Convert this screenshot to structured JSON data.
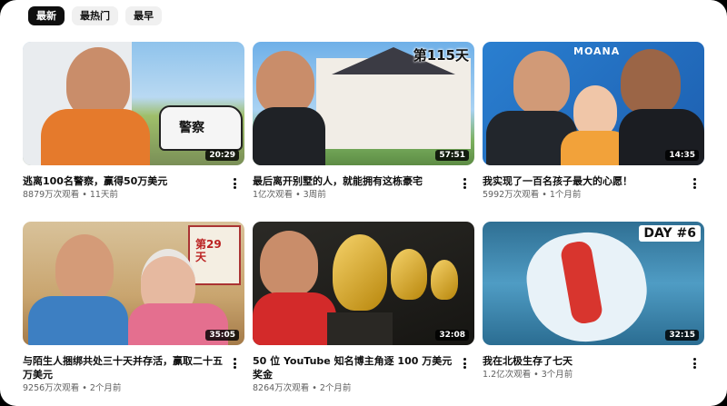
{
  "chips": [
    "最新",
    "最热门",
    "最早"
  ],
  "videos": [
    {
      "title": "逃离100名警察，赢得50万美元",
      "meta": "8879万次观看 • 11天前",
      "duration": "20:29",
      "overlay": "警察"
    },
    {
      "title": "最后离开别墅的人，就能拥有这栋豪宅",
      "meta": "1亿次观看 • 3周前",
      "duration": "57:51",
      "overlay": "第115天"
    },
    {
      "title": "我实现了一百名孩子最大的心愿！",
      "meta": "5992万次观看 • 1个月前",
      "duration": "14:35",
      "overlay": "MOANA"
    },
    {
      "title": "与陌生人捆绑共处三十天并存活，赢取二十五万美元",
      "meta": "9256万次观看 • 2个月前",
      "duration": "35:05",
      "overlay": "第29天"
    },
    {
      "title": "50 位 YouTube 知名博主角逐 100 万美元奖金",
      "meta": "8264万次观看 • 2个月前",
      "duration": "32:08",
      "overlay": ""
    },
    {
      "title": "我在北极生存了七天",
      "meta": "1.2亿次观看 • 3个月前",
      "duration": "32:15",
      "overlay": "DAY #6"
    }
  ],
  "colors": {
    "active_chip": "#0f0f0f",
    "chip": "#f0f0f0",
    "meta_text": "#606060"
  }
}
